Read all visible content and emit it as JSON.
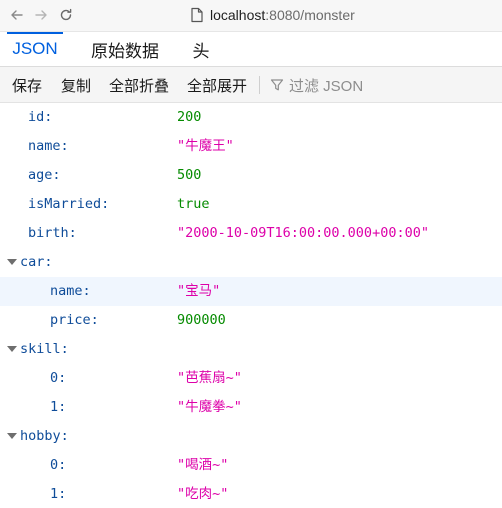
{
  "browser": {
    "url_host": "localhost",
    "url_rest": ":8080/monster",
    "back_icon": "arrow-left-icon",
    "forward_icon": "arrow-right-icon",
    "reload_icon": "reload-icon",
    "page_icon": "page-icon"
  },
  "tabs": [
    {
      "label": "JSON",
      "active": true
    },
    {
      "label": "原始数据",
      "active": false
    },
    {
      "label": "头",
      "active": false
    }
  ],
  "toolbar": {
    "save": "保存",
    "copy": "复制",
    "collapse_all": "全部折叠",
    "expand_all": "全部展开",
    "filter_placeholder": "过滤 JSON",
    "filter_icon": "funnel-icon"
  },
  "colors": {
    "accent": "#0060df",
    "key": "#0f4c99",
    "string": "#dd00a9",
    "number": "#058b00"
  },
  "json": {
    "id": {
      "key": "id:",
      "value": "200"
    },
    "name": {
      "key": "name:",
      "value": "\"牛魔王\""
    },
    "age": {
      "key": "age:",
      "value": "500"
    },
    "isMarried": {
      "key": "isMarried:",
      "value": "true"
    },
    "birth": {
      "key": "birth:",
      "value": "\"2000-10-09T16:00:00.000+00:00\""
    },
    "car": {
      "key": "car:",
      "name": {
        "key": "name:",
        "value": "\"宝马\""
      },
      "price": {
        "key": "price:",
        "value": "900000"
      }
    },
    "skill": {
      "key": "skill:",
      "items": [
        {
          "key": "0:",
          "value": "\"芭蕉扇~\""
        },
        {
          "key": "1:",
          "value": "\"牛魔拳~\""
        }
      ]
    },
    "hobby": {
      "key": "hobby:",
      "items": [
        {
          "key": "0:",
          "value": "\"喝酒~\""
        },
        {
          "key": "1:",
          "value": "\"吃肉~\""
        }
      ]
    }
  }
}
